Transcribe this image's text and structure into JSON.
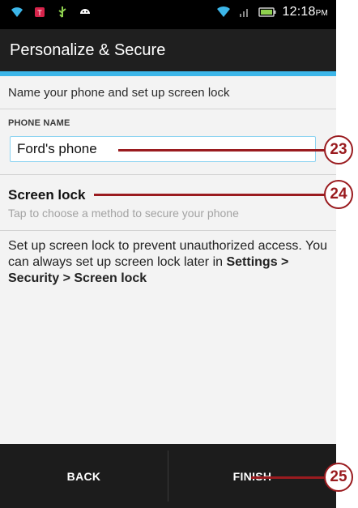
{
  "status_bar": {
    "time": "12:18",
    "ampm": "PM",
    "icons": [
      "wifi-icon",
      "notification-icon",
      "usb-icon",
      "android-icon",
      "wifi-signal-icon",
      "cell-signal-icon",
      "battery-icon"
    ]
  },
  "header": {
    "title": "Personalize & Secure"
  },
  "colors": {
    "accent": "#3cb6e9",
    "callout": "#9a1b1f"
  },
  "main": {
    "subtitle": "Name your phone and set up screen lock",
    "phone_name_label": "PHONE NAME",
    "phone_name_value": "Ford's phone",
    "screen_lock_title": "Screen lock",
    "screen_lock_subtitle": "Tap to choose a method to secure your phone",
    "description_part1": "Set up screen lock to prevent unauthorized access. You can always set up screen lock later in ",
    "description_bold": "Settings > Security > Screen lock"
  },
  "bottom_bar": {
    "back_label": "BACK",
    "finish_label": "FINISH"
  },
  "callouts": [
    "23",
    "24",
    "25"
  ]
}
